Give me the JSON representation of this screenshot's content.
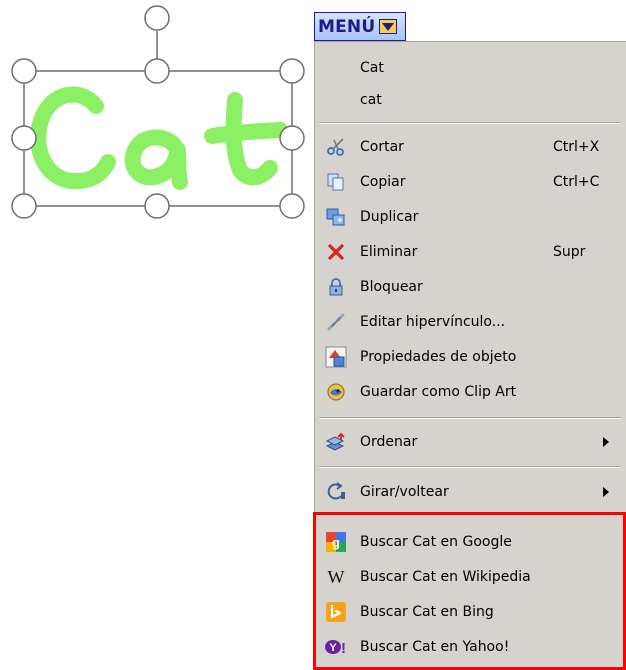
{
  "menu_button": {
    "label": "MENÚ",
    "arrow_icon": "triangle-down-icon"
  },
  "canvas_object": {
    "text": "Cat",
    "stroke_color": "#8cf064",
    "selected": true
  },
  "context_menu": {
    "background": "#d6d3ce",
    "text_items": [
      {
        "label": "Cat"
      },
      {
        "label": "cat"
      }
    ],
    "edit_items": [
      {
        "label": "Cortar",
        "shortcut": "Ctrl+X",
        "icon": "scissors-icon"
      },
      {
        "label": "Copiar",
        "shortcut": "Ctrl+C",
        "icon": "copy-icon"
      },
      {
        "label": "Duplicar",
        "shortcut": "",
        "icon": "duplicate-icon"
      },
      {
        "label": "Eliminar",
        "shortcut": "Supr",
        "icon": "delete-x-icon"
      },
      {
        "label": "Bloquear",
        "shortcut": "",
        "icon": "lock-icon"
      },
      {
        "label": "Editar hipervínculo...",
        "shortcut": "",
        "icon": "hyperlink-icon"
      },
      {
        "label": "Propiedades de objeto",
        "shortcut": "",
        "icon": "object-properties-icon"
      },
      {
        "label": "Guardar como Clip Art",
        "shortcut": "",
        "icon": "clip-art-icon"
      }
    ],
    "ordenar": {
      "label": "Ordenar",
      "icon": "arrange-icon"
    },
    "girar": {
      "label": "Girar/voltear",
      "icon": "rotate-icon"
    },
    "search_items": [
      {
        "label": "Buscar Cat en Google",
        "icon": "google-icon"
      },
      {
        "label": "Buscar Cat en Wikipedia",
        "icon": "wikipedia-icon"
      },
      {
        "label": "Buscar Cat en Bing",
        "icon": "bing-icon"
      },
      {
        "label": "Buscar Cat en Yahoo!",
        "icon": "yahoo-icon"
      }
    ],
    "highlight_color": "#ff0000"
  }
}
